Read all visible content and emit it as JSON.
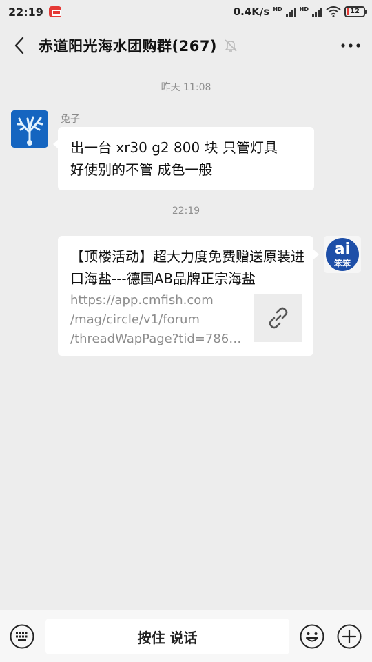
{
  "status_bar": {
    "time": "22:19",
    "net_speed": "0.4K/s",
    "signal_label_1": "HD",
    "signal_label_2": "HD",
    "battery": "12"
  },
  "header": {
    "title": "赤道阳光海水团购群(267)",
    "back_icon": "chevron-left-icon",
    "mute_icon": "bell-off-icon",
    "more_icon": "more-horizontal-icon"
  },
  "messages": [
    {
      "timestamp": "昨天 11:08",
      "sender": "兔子",
      "side": "left",
      "avatar_icon": "coral-avatar-icon",
      "lines": [
        "出一台 xr30 g2 800 块 只管灯具",
        "好使别的不管 成色一般"
      ]
    },
    {
      "timestamp": "22:19",
      "side": "right",
      "avatar_icon": "ai-logo-avatar-icon",
      "avatar_text": "笨笨",
      "link_title": "【顶楼活动】超大力度免费赠送原装进口海盐---德国AB品牌正宗海盐",
      "link_desc_lines": [
        "https://app.cmfish.com",
        "/mag/circle/v1/forum",
        "/threadWapPage?tid=786…"
      ],
      "link_icon": "link-icon"
    }
  ],
  "bottom_bar": {
    "keyboard_icon": "keyboard-icon",
    "voice_label": "按住 说话",
    "emoji_icon": "emoji-icon",
    "plus_icon": "plus-circle-icon"
  },
  "colors": {
    "background": "#ededed",
    "bubble": "#ffffff",
    "avatar_blue": "#1565c0"
  }
}
